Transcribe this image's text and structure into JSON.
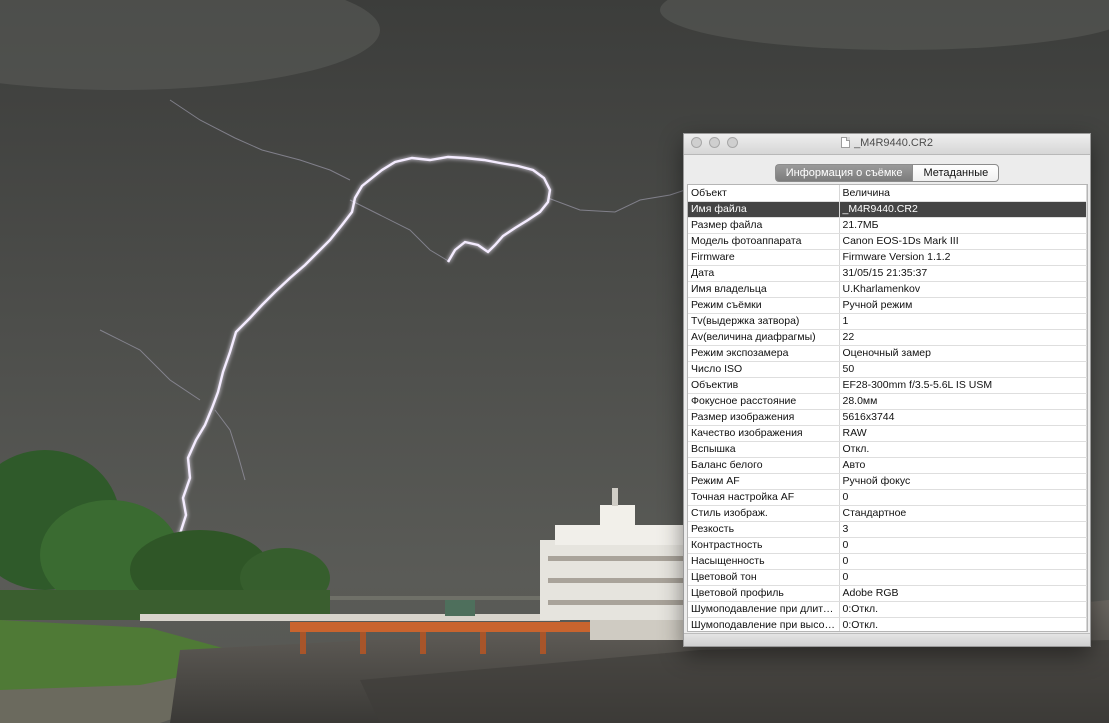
{
  "window": {
    "title": "_M4R9440.CR2",
    "file_icon": "document-icon"
  },
  "tabs": [
    {
      "label": "Информация о съёмке",
      "selected": true
    },
    {
      "label": "Метаданные",
      "selected": false
    }
  ],
  "table": {
    "headers": [
      "Объект",
      "Величина"
    ],
    "selected_row": 0,
    "rows": [
      [
        "Имя файла",
        "_M4R9440.CR2"
      ],
      [
        "Размер файла",
        "21.7МБ"
      ],
      [
        "Модель фотоаппарата",
        "Canon EOS-1Ds Mark III"
      ],
      [
        "Firmware",
        "Firmware Version 1.1.2"
      ],
      [
        "Дата",
        "31/05/15 21:35:37"
      ],
      [
        "Имя владельца",
        "U.Kharlamenkov"
      ],
      [
        "Режим съёмки",
        "Ручной режим"
      ],
      [
        "Tv(выдержка затвора)",
        "1"
      ],
      [
        "Av(величина диафрагмы)",
        "22"
      ],
      [
        "Режим экспозамера",
        "Оценочный замер"
      ],
      [
        "Число ISO",
        "50"
      ],
      [
        "Объектив",
        "EF28-300mm f/3.5-5.6L IS USM"
      ],
      [
        "Фокусное расстояние",
        "28.0мм"
      ],
      [
        "Размер изображения",
        "5616x3744"
      ],
      [
        "Качество изображения",
        "RAW"
      ],
      [
        "Вспышка",
        "Откл."
      ],
      [
        "Баланс белого",
        "Авто"
      ],
      [
        "Режим AF",
        "Ручной фокус"
      ],
      [
        "Точная настройка AF",
        "0"
      ],
      [
        "Стиль изображ.",
        "Стандартное"
      ],
      [
        "Резкость",
        "3"
      ],
      [
        "Контрастность",
        "0"
      ],
      [
        "Насыщенность",
        "0"
      ],
      [
        "Цветовой тон",
        "0"
      ],
      [
        "Цветовой профиль",
        "Adobe RGB"
      ],
      [
        "Шумоподавление при длительной выдержке",
        "0:Откл."
      ],
      [
        "Шумоподавление при высоких ISO",
        "0:Откл."
      ]
    ]
  },
  "colors": {
    "sky": "#4b4c49",
    "lightning": "#f4ecff",
    "selection": "#444444"
  }
}
